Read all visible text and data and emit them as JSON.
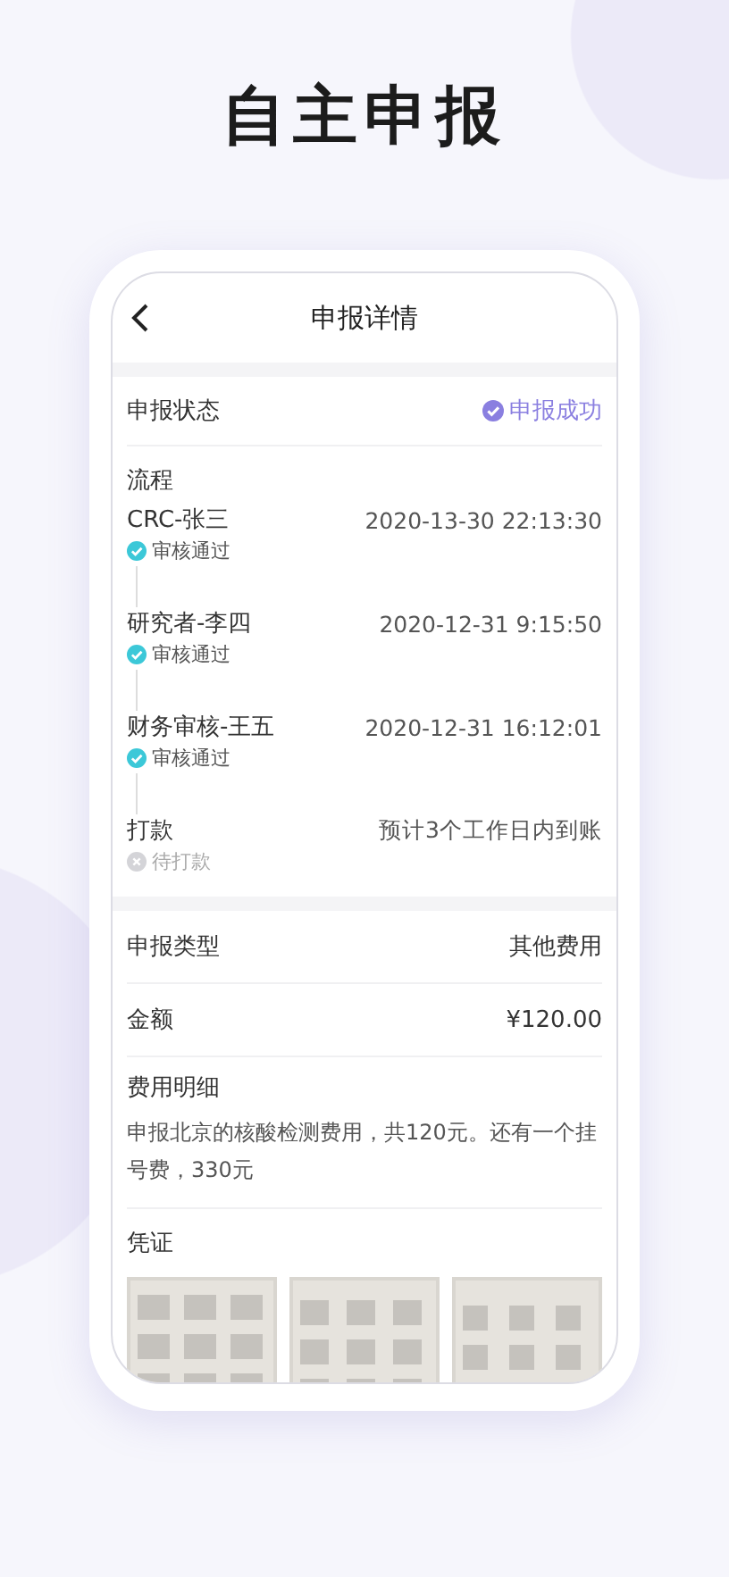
{
  "headline": "自主申报",
  "nav": {
    "title": "申报详情"
  },
  "status_row": {
    "label": "申报状态",
    "value": "申报成功"
  },
  "process": {
    "label": "流程",
    "steps": [
      {
        "name": "CRC-张三",
        "info": "2020-13-30 22:13:30",
        "approved": true,
        "status_text": "审核通过"
      },
      {
        "name": "研究者-李四",
        "info": "2020-12-31 9:15:50",
        "approved": true,
        "status_text": "审核通过"
      },
      {
        "name": "财务审核-王五",
        "info": "2020-12-31 16:12:01",
        "approved": true,
        "status_text": "审核通过"
      },
      {
        "name": "打款",
        "info": "预计3个工作日内到账",
        "approved": false,
        "status_text": "待打款"
      }
    ]
  },
  "fields": [
    {
      "label": "申报类型",
      "value": "其他费用"
    },
    {
      "label": "金额",
      "value": "¥120.00"
    }
  ],
  "details": {
    "label": "费用明细",
    "text": "申报北京的核酸检测费用，共120元。还有一个挂号费，330元"
  },
  "vouchers": {
    "label": "凭证"
  }
}
